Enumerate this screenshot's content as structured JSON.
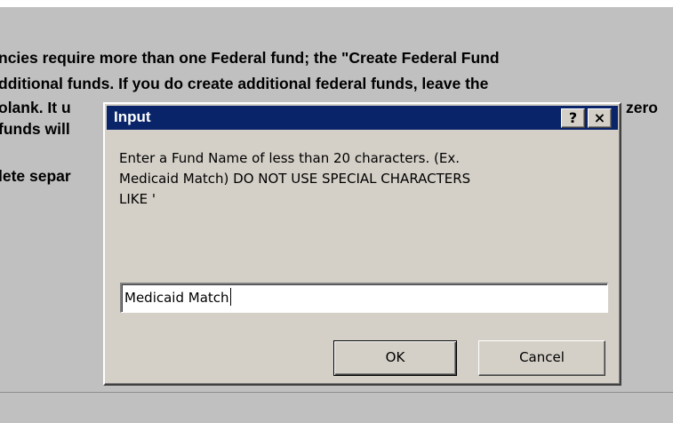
{
  "background_text": {
    "line1": "ncies require more than one Federal fund; the \"Create Federal Fund",
    "line2": "dditional funds.   If you do create additional federal funds, leave the",
    "line3_left": "olank.  It u",
    "line3_right": "zero",
    "line4": "funds will",
    "line5": "lete separ"
  },
  "dialog": {
    "title": "Input",
    "help_glyph": "?",
    "close_glyph": "×",
    "prompt": "Enter a Fund Name of less than 20 characters. (Ex.\nMedicaid Match) DO NOT USE SPECIAL CHARACTERS\nLIKE '",
    "input_value": "Medicaid Match",
    "ok_label": "OK",
    "cancel_label": "Cancel"
  },
  "colors": {
    "titlebar": "#0a246a",
    "dialog_face": "#d4d0c8",
    "sheet_background": "#c0c0c0"
  },
  "icons": {
    "help": "question-mark",
    "close": "x-mark"
  }
}
